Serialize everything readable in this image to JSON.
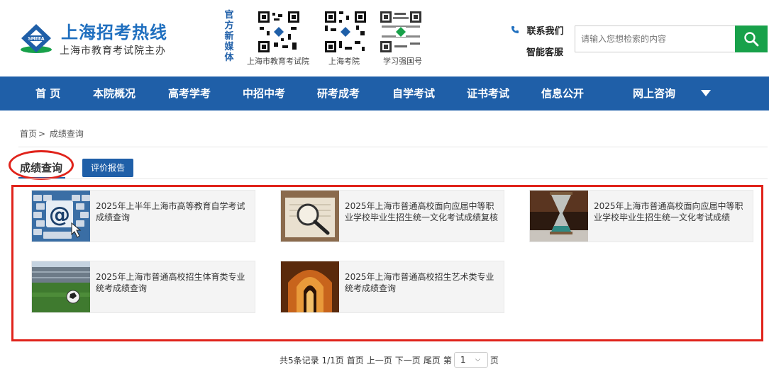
{
  "header": {
    "site_title": "上海招考热线",
    "site_subtitle": "上海市教育考试院主办",
    "logo_emblem_text": "SMEEA",
    "media_label": [
      "官",
      "方",
      "新",
      "媒",
      "体"
    ],
    "qr_codes": [
      {
        "label": "上海市教育考试院"
      },
      {
        "label": "上海考院"
      },
      {
        "label": "学习强国号"
      }
    ],
    "contact_label": "联系我们",
    "service_label": "智能客服",
    "search_placeholder": "请输入您想检索的内容",
    "colors": {
      "brand_blue": "#1f5fa8",
      "search_green": "#18a14a",
      "highlight_red": "#e0231b"
    }
  },
  "nav": {
    "items": [
      "首 页",
      "本院概况",
      "高考学考",
      "中招中考",
      "研考成考",
      "自学考试",
      "证书考试",
      "信息公开",
      "网上咨询"
    ],
    "more_icon": "caret-down-icon"
  },
  "breadcrumb": {
    "home": "首页",
    "separator": ">",
    "current": "成绩查询"
  },
  "tabs": {
    "active": "成绩查询",
    "secondary": "评价报告"
  },
  "cards": [
    {
      "title": "2025年上半年上海市高等教育自学考试成绩查询",
      "image": "keyboard-at-image"
    },
    {
      "title": "2025年上海市普通高校面向应届中等职业学校毕业生招生统一文化考试成绩复核",
      "image": "magnifier-image"
    },
    {
      "title": "2025年上海市普通高校面向应届中等职业学校毕业生招生统一文化考试成绩",
      "image": "hourglass-image"
    },
    {
      "title": "2025年上海市普通高校招生体育类专业统考成绩查询",
      "image": "stadium-image"
    },
    {
      "title": "2025年上海市普通高校招生艺术类专业统考成绩查询",
      "image": "arch-image"
    }
  ],
  "pager": {
    "summary": "共5条记录 1/1页",
    "first": "首页",
    "prev": "上一页",
    "next": "下一页",
    "last": "尾页",
    "goto_prefix": "第",
    "page_value": "1",
    "goto_suffix": "页"
  }
}
